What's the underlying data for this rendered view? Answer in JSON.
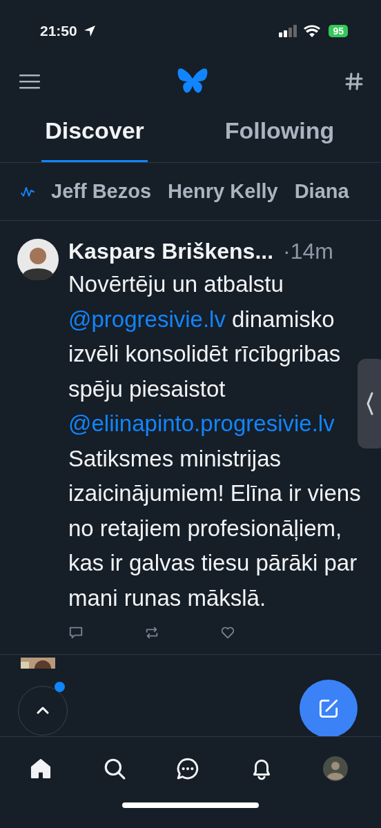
{
  "status_bar": {
    "time": "21:50",
    "battery": "95"
  },
  "tabs": [
    {
      "label": "Discover",
      "selected": true
    },
    {
      "label": "Following",
      "selected": false
    }
  ],
  "trending": [
    "Jeff Bezos",
    "Henry Kelly",
    "Diana"
  ],
  "post": {
    "author": "Kaspars Briškens...",
    "time": "·14m",
    "text": [
      {
        "kind": "text",
        "text": "Novērtēju un atbalstu "
      },
      {
        "kind": "mention",
        "text": "@progresivie.lv"
      },
      {
        "kind": "text",
        "text": " dinamisko izvēli konsolidēt rīcībgribas spēju piesaistot "
      },
      {
        "kind": "mention",
        "text": "@eliinapinto.progresivie.lv"
      },
      {
        "kind": "text",
        "text": " Satiksmes ministrijas izaicinājumiem! Elīna ir viens no retajiem profesionāļiem, kas ir galvas tiesu pārāki par mani runas mākslā."
      }
    ]
  },
  "scroll_top": {
    "unread": true
  },
  "bottom_nav": [
    {
      "kind": "home",
      "selected": true
    },
    {
      "kind": "search",
      "selected": false
    },
    {
      "kind": "chat",
      "selected": false
    },
    {
      "kind": "bell",
      "selected": false
    },
    {
      "kind": "avatar",
      "selected": false
    }
  ]
}
